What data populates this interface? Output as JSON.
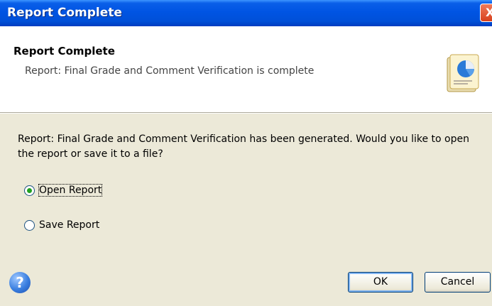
{
  "window": {
    "title": "Report Complete",
    "close_glyph": "X"
  },
  "header": {
    "title": "Report Complete",
    "subtitle": "Report: Final Grade and Comment Verification is complete",
    "icon": "report-pie-chart-icon"
  },
  "body": {
    "message": "Report: Final Grade and Comment Verification has been generated. Would you like to open the report or save it to a file?",
    "options": [
      {
        "label": "Open Report",
        "selected": true
      },
      {
        "label": "Save Report",
        "selected": false
      }
    ]
  },
  "footer": {
    "help_glyph": "?",
    "ok_label": "OK",
    "cancel_label": "Cancel"
  },
  "colors": {
    "titlebar": "#0054e3",
    "dialog_bg": "#ece9d8",
    "header_bg": "#ffffff",
    "radio_selected": "#21a121"
  }
}
